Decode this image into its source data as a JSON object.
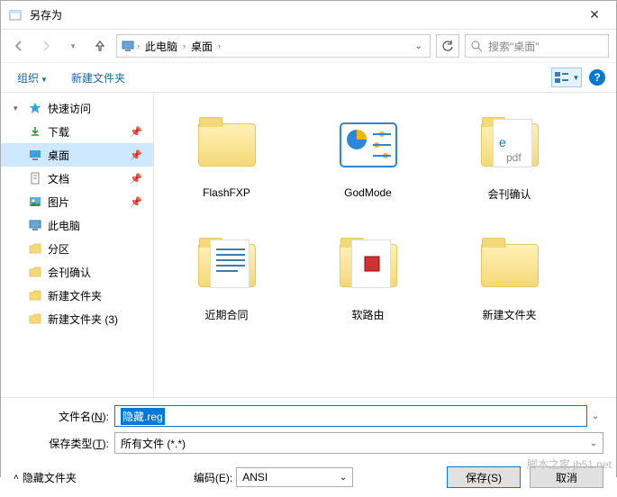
{
  "window": {
    "title": "另存为"
  },
  "nav": {
    "path": [
      "此电脑",
      "桌面"
    ],
    "search_placeholder": "搜索\"桌面\""
  },
  "toolbar": {
    "organize": "组织",
    "new_folder": "新建文件夹"
  },
  "sidebar": {
    "quick_access": "快速访问",
    "items": [
      {
        "label": "下载",
        "pinned": true
      },
      {
        "label": "桌面",
        "pinned": true,
        "selected": true
      },
      {
        "label": "文档",
        "pinned": true
      },
      {
        "label": "图片",
        "pinned": true
      },
      {
        "label": "此电脑",
        "pinned": false
      },
      {
        "label": "分区",
        "pinned": false
      },
      {
        "label": "会刊确认",
        "pinned": false
      },
      {
        "label": "新建文件夹",
        "pinned": false
      },
      {
        "label": "新建文件夹 (3)",
        "pinned": false
      }
    ]
  },
  "content": {
    "items": [
      {
        "label": "FlashFXP",
        "type": "folder"
      },
      {
        "label": "GodMode",
        "type": "special"
      },
      {
        "label": "会刊确认",
        "type": "docfolder"
      },
      {
        "label": "近期合同",
        "type": "docfolder"
      },
      {
        "label": "软路由",
        "type": "folder-inner"
      },
      {
        "label": "新建文件夹",
        "type": "folder"
      }
    ]
  },
  "form": {
    "filename_label": "文件名(N):",
    "filename_value": "隐藏.reg",
    "type_label": "保存类型(T):",
    "type_value": "所有文件 (*.*)",
    "hide_folders": "隐藏文件夹",
    "encoding_label": "编码(E):",
    "encoding_value": "ANSI",
    "save": "保存(S)",
    "cancel": "取消"
  },
  "watermark": "脚本之家 jb51.net"
}
